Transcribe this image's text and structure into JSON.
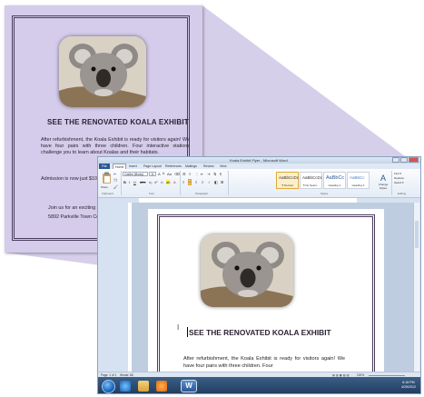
{
  "flyer": {
    "heading": "SEE THE RENOVATED KOALA EXHIBIT",
    "paragraph_1": "After refurbishment, the Koala Exhibit is ready for visitors again! We have four pairs with three children. Four interactive stations challenge you to learn about Koalas and their habitats.",
    "paragraph_2": "Admission is now just $10 for adults and $5 for children under 12.",
    "line_join": "Join us for an exciting adventure!",
    "line_address": "5892 Parkville Town Center"
  },
  "word": {
    "window_title": "Koala Exhibit Flyer - Microsoft Word",
    "tabs": [
      "File",
      "Home",
      "Insert",
      "Page Layout",
      "References",
      "Mailings",
      "Review",
      "View"
    ],
    "font_name": "Calibri (Body)",
    "font_size": "11",
    "group_labels": {
      "clipboard": "Clipboard",
      "font": "Font",
      "paragraph": "Paragraph",
      "styles": "Styles",
      "editing": "Editing"
    },
    "paste_label": "Paste",
    "styles": [
      {
        "sample": "AaBbCcDc",
        "name": "¶ Normal"
      },
      {
        "sample": "AaBbCcDc",
        "name": "¶ No Spaci..."
      },
      {
        "sample": "AaBbCc",
        "name": "Heading 1"
      },
      {
        "sample": "AaBbCc",
        "name": "Heading 2"
      }
    ],
    "change_styles_label": "Change Styles",
    "editing_items": [
      "Find ▾",
      "Replace",
      "Select ▾"
    ],
    "doc_heading": "SEE THE RENOVATED KOALA EXHIBIT",
    "doc_paragraph": "After refurbishment, the Koala Exhibit is ready for visitors again! We have four pairs with three children. Four",
    "status_page": "Page: 1 of 1",
    "status_words": "Words: 68",
    "zoom_level": "100%",
    "clock_time": "6:18 PM",
    "clock_date": "4/25/2012"
  },
  "colors": {
    "flyer_background": "#d4ccea",
    "frame_border": "#4a3b5e",
    "word_chrome": "#d6e2f1",
    "file_tab": "#2b5797",
    "taskbar": "#1f3a5c"
  }
}
